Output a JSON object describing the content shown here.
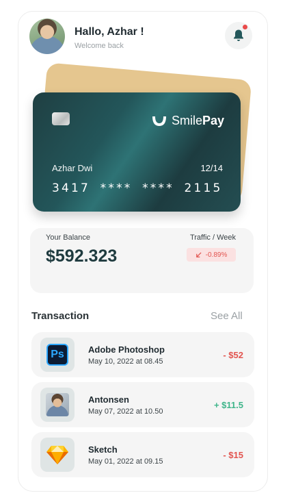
{
  "header": {
    "greeting": "Hallo, Azhar !",
    "subtitle": "Welcome back",
    "avatar_icon": "user-avatar",
    "bell_icon": "bell-icon",
    "has_notification": true
  },
  "card": {
    "brand_smile": "Smile",
    "brand_pay": "Pay",
    "holder": "Azhar Dwi",
    "expiry": "12/14",
    "number": "3417 **** **** 2115",
    "colors": {
      "card": "#23565a",
      "back_card": "#e5c68f"
    }
  },
  "balance": {
    "label": "Your Balance",
    "value": "$592.323",
    "traffic_label": "Traffic / Week",
    "traffic_value": "-0.89%"
  },
  "transactions": {
    "title": "Transaction",
    "see_all": "See All",
    "items": [
      {
        "name": "Adobe Photoshop",
        "date": "May 10, 2022 at 08.45",
        "amount": "- $52",
        "icon": "photoshop-icon",
        "icon_text": "Ps"
      },
      {
        "name": "Antonsen",
        "date": "May 07, 2022 at 10.50",
        "amount": "+ $11.5",
        "icon": "person-avatar"
      },
      {
        "name": "Sketch",
        "date": "May 01, 2022 at 09.15",
        "amount": "- $15",
        "icon": "sketch-icon"
      }
    ]
  },
  "colors": {
    "negative": "#e2544f",
    "positive": "#3fb58a",
    "accent": "#1f3b3f"
  }
}
